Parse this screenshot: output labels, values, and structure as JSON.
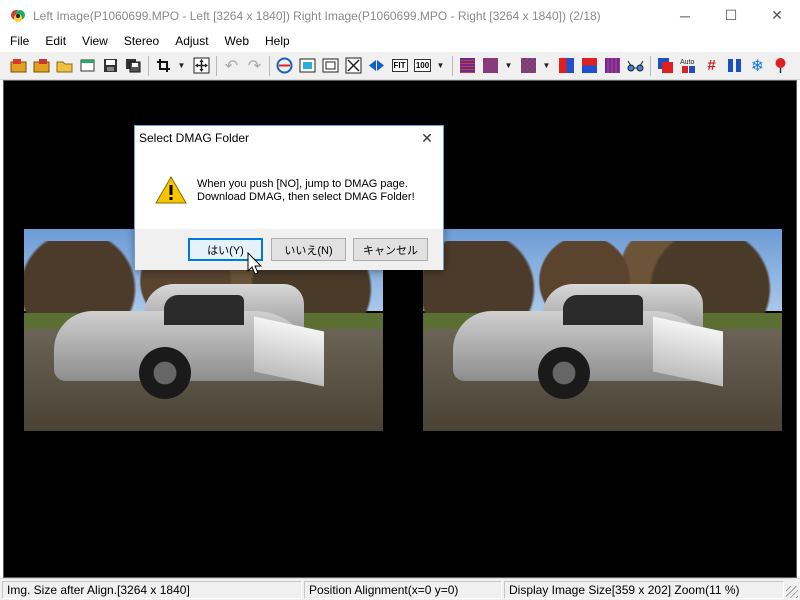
{
  "window": {
    "title": "Left Image(P1060699.MPO - Left [3264 x 1840]) Right Image(P1060699.MPO - Right [3264 x 1840])  (2/18)",
    "minimize_glyph": "─",
    "maximize_glyph": "☐",
    "close_glyph": "✕"
  },
  "menu": {
    "items": [
      "File",
      "Edit",
      "View",
      "Stereo",
      "Adjust",
      "Web",
      "Help"
    ]
  },
  "toolbar": {
    "fit_label": "FIT",
    "zoom100_label": "100",
    "auto_label": "Auto",
    "hash_glyph": "#",
    "snowflake_glyph": "❄",
    "dropdown_glyph": "▼",
    "undo_glyph": "↶",
    "redo_glyph": "↷"
  },
  "dialog": {
    "title": "Select DMAG Folder",
    "close_glyph": "✕",
    "message_line1": "When you push [NO], jump to DMAG page.",
    "message_line2": "Download DMAG, then select DMAG Folder!",
    "yes_label": "はい(Y)",
    "no_label": "いいえ(N)",
    "cancel_label": "キャンセル"
  },
  "status": {
    "pane1": "Img. Size after Align.[3264 x 1840]",
    "pane2": "Position Alignment(x=0 y=0)",
    "pane3": "Display Image Size[359 x 202]  Zoom(11 %)"
  },
  "colors": {
    "viewport_bg": "#000000",
    "dialog_accent": "#0078d7",
    "warning_yellow": "#f7c600"
  }
}
